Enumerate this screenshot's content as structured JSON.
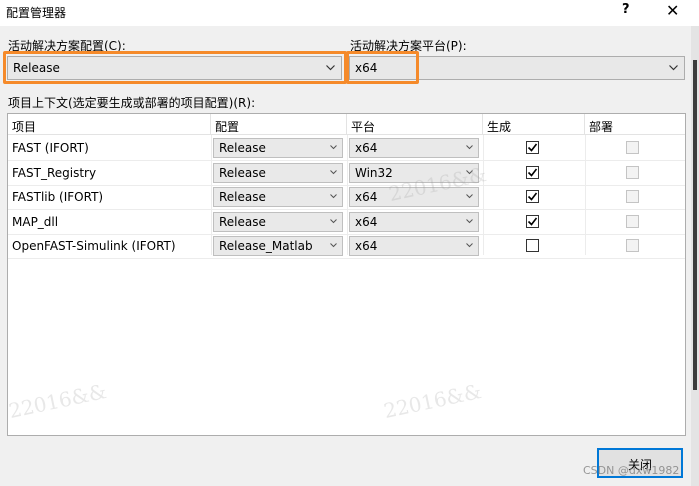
{
  "window": {
    "title": "配置管理器",
    "help": "?",
    "close": "✕"
  },
  "active_config": {
    "label": "活动解决方案配置(C):",
    "value": "Release"
  },
  "active_platform": {
    "label": "活动解决方案平台(P):",
    "value": "x64"
  },
  "grid": {
    "label": "项目上下文(选定要生成或部署的项目配置)(R):",
    "columns": [
      "项目",
      "配置",
      "平台",
      "生成",
      "部署"
    ],
    "rows": [
      {
        "project": "FAST (IFORT)",
        "config": "Release",
        "platform": "x64",
        "build": true,
        "deploy": false
      },
      {
        "project": "FAST_Registry",
        "config": "Release",
        "platform": "Win32",
        "build": true,
        "deploy": false
      },
      {
        "project": "FASTlib (IFORT)",
        "config": "Release",
        "platform": "x64",
        "build": true,
        "deploy": false
      },
      {
        "project": "MAP_dll",
        "config": "Release",
        "platform": "x64",
        "build": true,
        "deploy": false
      },
      {
        "project": "OpenFAST-Simulink (IFORT)",
        "config": "Release_Matlab",
        "platform": "x64",
        "build": false,
        "deploy": false
      }
    ]
  },
  "close_button": {
    "label": "关闭"
  },
  "watermark": {
    "text": "22016&&",
    "credit": "CSDN @dxw1982"
  },
  "colors": {
    "highlight": "#f58a2a",
    "focus": "#0078d7"
  }
}
